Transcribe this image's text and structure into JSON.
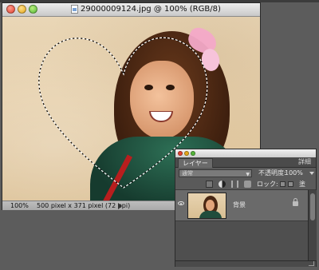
{
  "document_window": {
    "title": "29000009124.jpg @ 100% (RGB/8)",
    "zoom": "100%",
    "doc_info": "500 pixel x 371 pixel (72 ppi)",
    "selection_shape": "heart-shaped marquee selection"
  },
  "layers_panel": {
    "tab_label": "レイヤー",
    "menu_label": "詳細",
    "blend_mode": "通常",
    "opacity_label": "不透明度:",
    "opacity_value": "100%",
    "lock_label": "ロック:",
    "fill_label": "塗",
    "layers": [
      {
        "name": "背景",
        "visible": true,
        "locked": true
      }
    ]
  },
  "colors": {
    "background": "#5c5c5c",
    "panel": "#5a5a5a",
    "titlebar": "#dcdcdc"
  },
  "icons": [
    "close-icon",
    "minimize-icon",
    "zoom-icon",
    "document-icon",
    "eye-icon",
    "lock-icon"
  ]
}
